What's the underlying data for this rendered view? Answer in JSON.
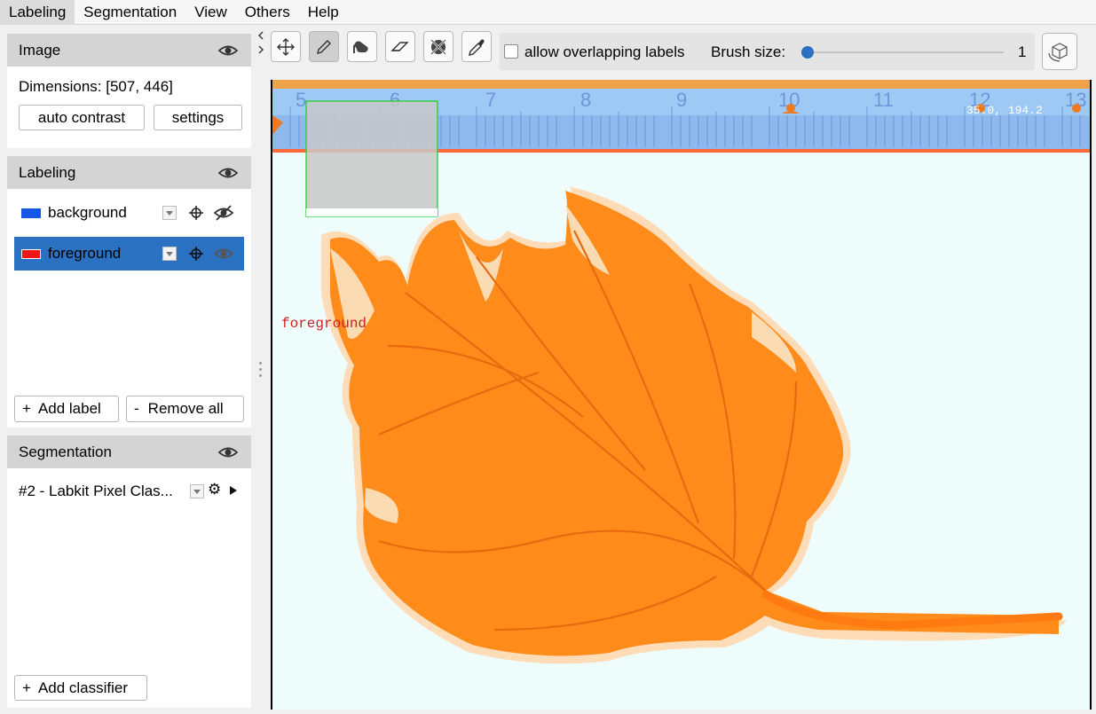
{
  "menu": {
    "items": [
      "Labeling",
      "Segmentation",
      "View",
      "Others",
      "Help"
    ]
  },
  "image_panel": {
    "title": "Image",
    "dimensions": "Dimensions: [507, 446]",
    "auto_contrast": "auto contrast",
    "settings": "settings"
  },
  "labeling_panel": {
    "title": "Labeling",
    "labels": [
      {
        "name": "background",
        "color": "#1556e8"
      },
      {
        "name": "foreground",
        "color": "#f01515"
      }
    ],
    "add_label": "Add label",
    "remove_all": "Remove all"
  },
  "segmentation_panel": {
    "title": "Segmentation",
    "classifier": "#2 - Labkit Pixel Clas...",
    "add_classifier": "Add classifier"
  },
  "toolbar": {
    "overlap_label": "allow overlapping labels",
    "brush_label": "Brush size:",
    "brush_value": "1",
    "brush_fraction": 0.0
  },
  "canvas": {
    "overlay_label": "foreground",
    "ruler_ticks": [
      "5",
      "6",
      "7",
      "8",
      "9",
      "10",
      "11",
      "12",
      "13"
    ],
    "coord_text": "35.0, 194.2",
    "leaf_color": "#ff8c1a",
    "selection_color": "#22d22a"
  },
  "accent": "#2b71c2"
}
